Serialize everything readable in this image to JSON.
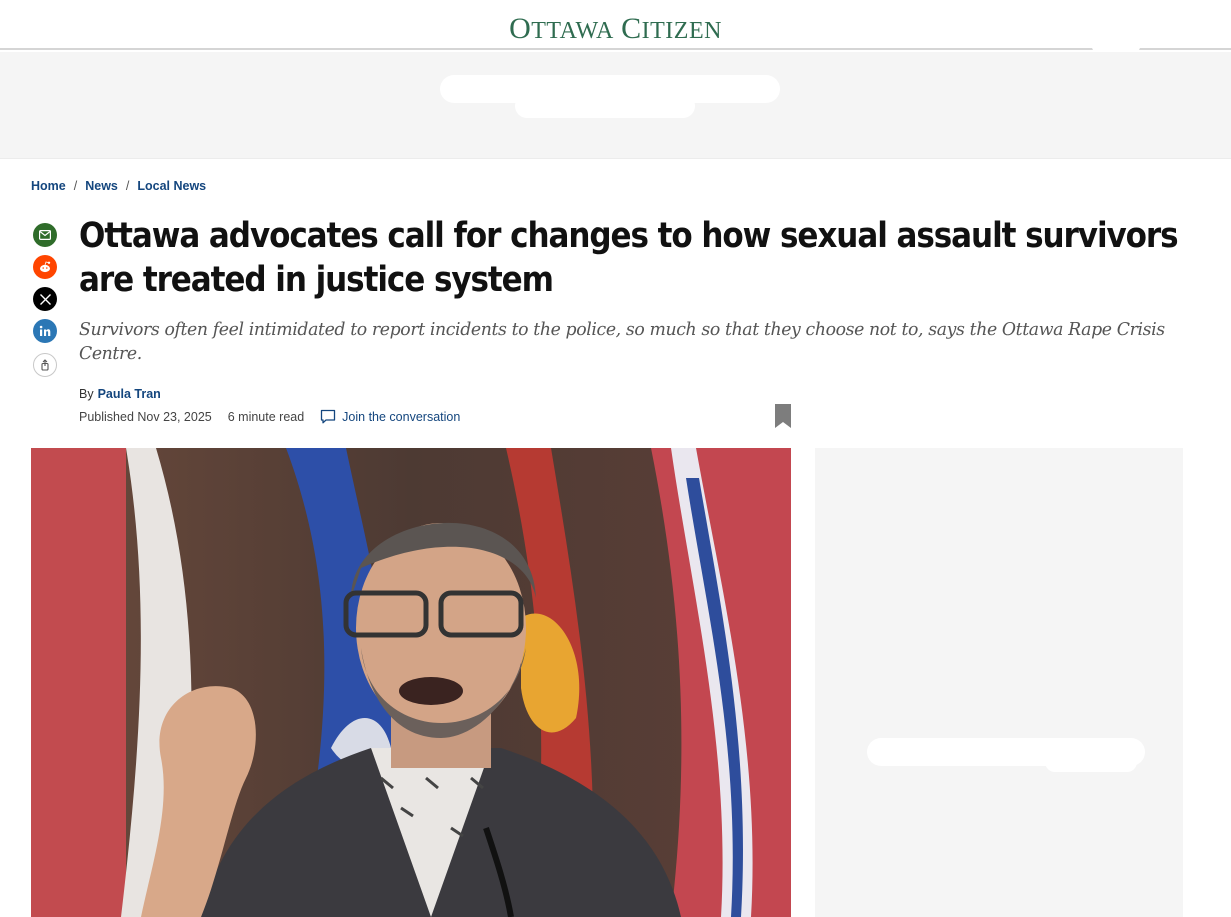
{
  "masthead": {
    "logo_first_initial": "O",
    "logo_first_rest": "TTAWA",
    "logo_second_initial": "C",
    "logo_second_rest": "ITIZEN"
  },
  "breadcrumb": {
    "items": [
      {
        "label": "Home"
      },
      {
        "label": "News"
      },
      {
        "label": "Local News"
      }
    ],
    "separator": "/"
  },
  "share": {
    "icons": [
      "email-icon",
      "reddit-icon",
      "x-icon",
      "linkedin-icon",
      "share-icon"
    ]
  },
  "article": {
    "headline": "Ottawa advocates call for changes to how sexual assault survivors are treated in justice system",
    "dek": "Survivors often feel intimidated to report incidents to the police, so much so that they choose not to, says the Ottawa Rape Crisis Centre.",
    "byline_prefix": "By",
    "author": "Paula Tran",
    "published": "Published Nov 23, 2025",
    "read_time": "6 minute read",
    "conversation_label": "Join the conversation"
  },
  "colors": {
    "brand_green": "#2f6c50",
    "link_blue": "#14467e",
    "email_green": "#2f6c2a",
    "reddit_orange": "#ff4500",
    "linkedin_blue": "#2b77b5"
  }
}
